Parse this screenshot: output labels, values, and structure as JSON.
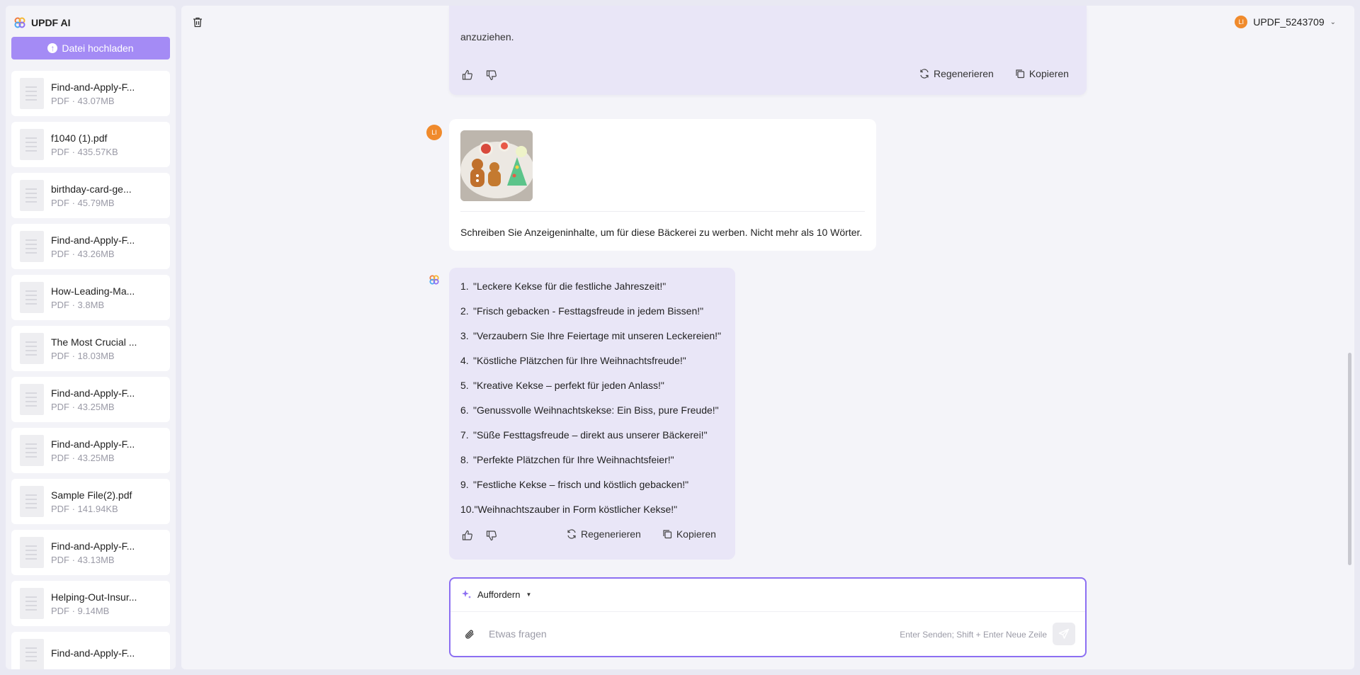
{
  "app": {
    "title": "UPDF AI"
  },
  "sidebar": {
    "upload_label": "Datei hochladen",
    "files": [
      {
        "name": "Find-and-Apply-F...",
        "meta": "PDF · 43.07MB"
      },
      {
        "name": "f1040 (1).pdf",
        "meta": "PDF · 435.57KB"
      },
      {
        "name": "birthday-card-ge...",
        "meta": "PDF · 45.79MB"
      },
      {
        "name": "Find-and-Apply-F...",
        "meta": "PDF · 43.26MB"
      },
      {
        "name": "How-Leading-Ma...",
        "meta": "PDF · 3.8MB"
      },
      {
        "name": "The Most Crucial ...",
        "meta": "PDF · 18.03MB"
      },
      {
        "name": "Find-and-Apply-F...",
        "meta": "PDF · 43.25MB"
      },
      {
        "name": "Find-and-Apply-F...",
        "meta": "PDF · 43.25MB"
      },
      {
        "name": "Sample File(2).pdf",
        "meta": "PDF · 141.94KB"
      },
      {
        "name": "Find-and-Apply-F...",
        "meta": "PDF · 43.13MB"
      },
      {
        "name": "Helping-Out-Insur...",
        "meta": "PDF · 9.14MB"
      },
      {
        "name": "Find-and-Apply-F...",
        "meta": ""
      }
    ]
  },
  "header": {
    "user_name": "UPDF_5243709",
    "avatar_initials": "LI"
  },
  "chat": {
    "prev_answer_tail": "anzuziehen.",
    "regenerate_label": "Regenerieren",
    "copy_label": "Kopieren",
    "user_message": "Schreiben Sie Anzeigeninhalte, um für diese Bäckerei zu werben. Nicht mehr als 10 Wörter.",
    "ai_answer": [
      {
        "num": "1.",
        "text": "\"Leckere Kekse für die festliche Jahreszeit!\""
      },
      {
        "num": "2.",
        "text": "\"Frisch gebacken - Festtagsfreude in jedem Bissen!\""
      },
      {
        "num": "3.",
        "text": "\"Verzaubern Sie Ihre Feiertage mit unseren Leckereien!\""
      },
      {
        "num": "4.",
        "text": "\"Köstliche Plätzchen für Ihre Weihnachtsfreude!\""
      },
      {
        "num": "5.",
        "text": "\"Kreative Kekse – perfekt für jeden Anlass!\""
      },
      {
        "num": "6.",
        "text": "\"Genussvolle Weihnachtskekse: Ein Biss, pure Freude!\""
      },
      {
        "num": "7.",
        "text": "\"Süße Festtagsfreude – direkt aus unserer Bäckerei!\""
      },
      {
        "num": "8.",
        "text": "\"Perfekte Plätzchen für Ihre Weihnachtsfeier!\""
      },
      {
        "num": "9.",
        "text": "\"Festliche Kekse – frisch und köstlich gebacken!\""
      },
      {
        "num": "10.",
        "text": "\"Weihnachtszauber in Form köstlicher Kekse!\""
      }
    ]
  },
  "composer": {
    "prompt_label": "Auffordern",
    "placeholder": "Etwas fragen",
    "hint": "Enter Senden; Shift + Enter Neue Zeile"
  },
  "colors": {
    "accent": "#8c6ff2",
    "upload_button": "#a48bf5",
    "ai_bubble": "#e9e6f7",
    "avatar": "#f08a2c"
  }
}
